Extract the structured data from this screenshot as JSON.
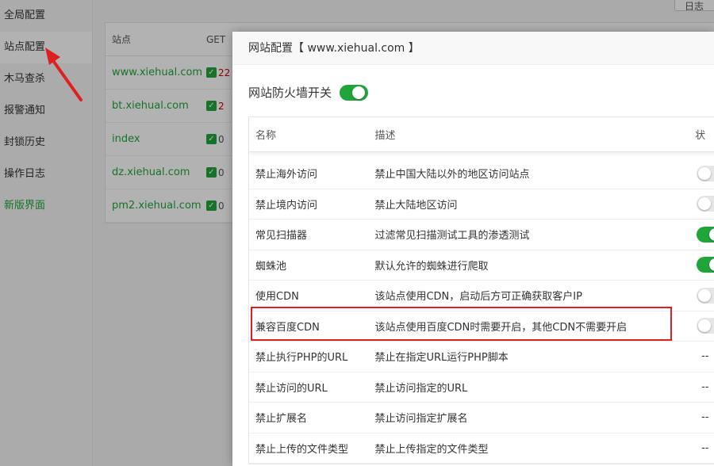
{
  "sidebar": {
    "items": [
      {
        "label": "全局配置"
      },
      {
        "label": "站点配置"
      },
      {
        "label": "木马查杀"
      },
      {
        "label": "报警通知"
      },
      {
        "label": "封锁历史"
      },
      {
        "label": "操作日志"
      },
      {
        "label": "新版界面"
      }
    ]
  },
  "top_button": {
    "label": "日志"
  },
  "site_table": {
    "headers": [
      "站点",
      "GET"
    ],
    "rows": [
      {
        "site": "www.xiehual.com",
        "get": "22"
      },
      {
        "site": "bt.xiehual.com",
        "get": "2"
      },
      {
        "site": "index",
        "get": "0"
      },
      {
        "site": "dz.xiehual.com",
        "get": "0"
      },
      {
        "site": "pm2.xiehual.com",
        "get": "0"
      }
    ]
  },
  "modal": {
    "title": "网站配置【 www.xiehual.com 】",
    "firewall_label": "网站防火墙开关",
    "firewall_on": true,
    "columns": {
      "name": "名称",
      "desc": "描述",
      "status": "状"
    },
    "rules": [
      {
        "name": "禁止海外访问",
        "desc": "禁止中国大陆以外的地区访问站点",
        "status": "off"
      },
      {
        "name": "禁止境内访问",
        "desc": "禁止大陆地区访问",
        "status": "off"
      },
      {
        "name": "常见扫描器",
        "desc": "过滤常见扫描测试工具的渗透测试",
        "status": "on"
      },
      {
        "name": "蜘蛛池",
        "desc": "默认允许的蜘蛛进行爬取",
        "status": "on"
      },
      {
        "name": "使用CDN",
        "desc": "该站点使用CDN，启动后方可正确获取客户IP",
        "status": "off"
      },
      {
        "name": "兼容百度CDN",
        "desc": "该站点使用百度CDN时需要开启，其他CDN不需要开启",
        "status": "off"
      },
      {
        "name": "禁止执行PHP的URL",
        "desc": "禁止在指定URL运行PHP脚本",
        "status": "--"
      },
      {
        "name": "禁止访问的URL",
        "desc": "禁止访问指定的URL",
        "status": "--"
      },
      {
        "name": "禁止扩展名",
        "desc": "禁止访问指定扩展名",
        "status": "--"
      },
      {
        "name": "禁止上传的文件类型",
        "desc": "禁止上传指定的文件类型",
        "status": "--"
      }
    ]
  },
  "colors": {
    "accent": "#20a53a",
    "highlight": "#e02020"
  }
}
